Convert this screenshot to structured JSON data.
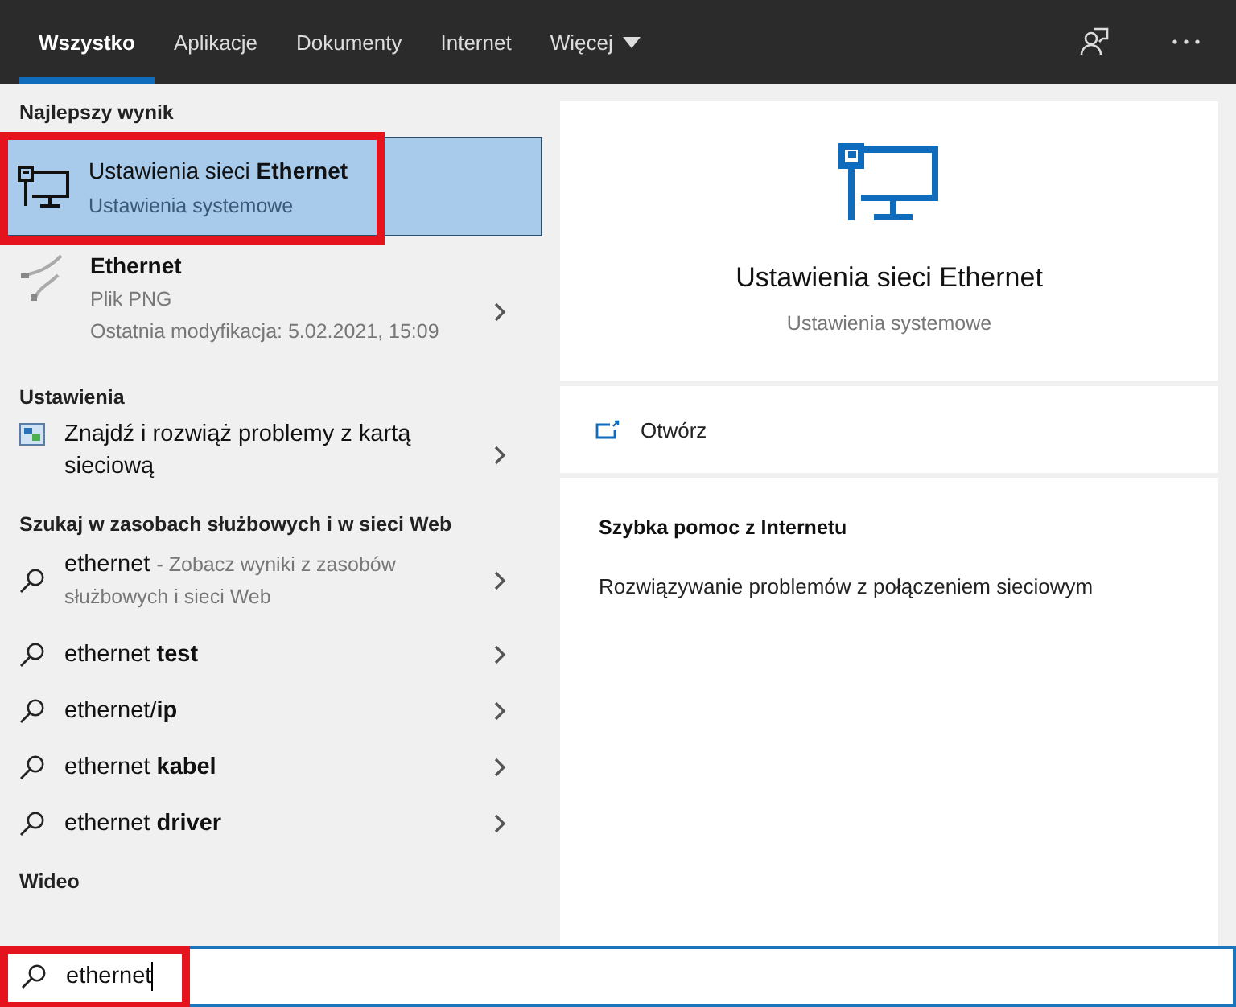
{
  "tabs": [
    {
      "label": "Wszystko",
      "selected": true,
      "dropdown": false
    },
    {
      "label": "Aplikacje",
      "selected": false,
      "dropdown": false
    },
    {
      "label": "Dokumenty",
      "selected": false,
      "dropdown": false
    },
    {
      "label": "Internet",
      "selected": false,
      "dropdown": false
    },
    {
      "label": "Więcej",
      "selected": false,
      "dropdown": true
    }
  ],
  "results": [
    {
      "kind": "section",
      "label": "Najlepszy wynik"
    },
    {
      "kind": "best",
      "title": "Ustawienia sieci **Ethernet**",
      "subtitle": "Ustawienia systemowe",
      "selected": true,
      "highlighted": true
    },
    {
      "kind": "file",
      "title": "Ethernet",
      "lines": [
        "Plik PNG",
        "Ostatnia modyfikacja: 5.02.2021, 15:09"
      ]
    },
    {
      "kind": "section",
      "label": "Ustawienia"
    },
    {
      "kind": "setting",
      "title": "Znajdź i rozwiąż problemy z kartą sieciową"
    },
    {
      "kind": "section",
      "label": "Szukaj w zasobach służbowych i w sieci Web"
    },
    {
      "kind": "web",
      "title": "ethernet",
      "hint": "- Zobacz wyniki z zasobów służbowych i sieci Web"
    },
    {
      "kind": "suggestion",
      "title": "ethernet **test**"
    },
    {
      "kind": "suggestion",
      "title": "ethernet/**ip**"
    },
    {
      "kind": "suggestion",
      "title": "ethernet **kabel**"
    },
    {
      "kind": "suggestion",
      "title": "ethernet **driver**"
    },
    {
      "kind": "section",
      "label": "Wideo"
    }
  ],
  "preview": {
    "title": "Ustawienia sieci Ethernet",
    "subtitle": "Ustawienia systemowe",
    "open_label": "Otwórz",
    "help_title": "Szybka pomoc z Internetu",
    "help_links": [
      "Rozwiązywanie problemów z połączeniem sieciowym"
    ]
  },
  "search": {
    "value": "ethernet",
    "highlighted": true
  }
}
